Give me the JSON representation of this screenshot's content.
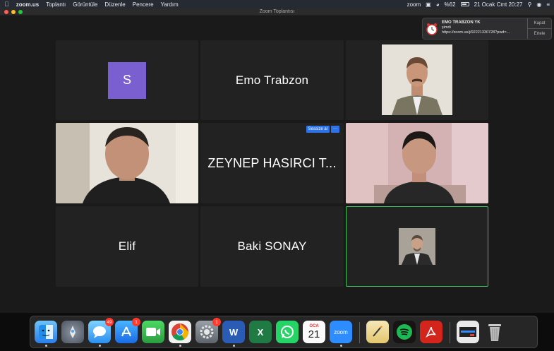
{
  "menubar": {
    "app_name": "zoom.us",
    "menus": [
      "Toplantı",
      "Görüntüle",
      "Düzenle",
      "Pencere",
      "Yardım"
    ],
    "status_app": "zoom",
    "battery": "%62",
    "datetime": "21 Ocak Cmt  20:27"
  },
  "window": {
    "title": "Zoom Toplantısı"
  },
  "tiles": {
    "t1": {
      "avatar_letter": "S"
    },
    "t2": {
      "name": "Emo Trabzon"
    },
    "t5": {
      "name": "ZEYNEP HASIRCI T...",
      "mute_label": "Sessize al",
      "more_label": "···"
    },
    "t7": {
      "name": "Elif"
    },
    "t8": {
      "name": "Baki SONAY"
    }
  },
  "notification": {
    "title": "EMO TRABZON YK",
    "subtitle": "şimdi",
    "url": "https://zoom.us/j/92221330728?pwd=...",
    "close_label": "Kapat",
    "snooze_label": "Ertele"
  },
  "dock": {
    "badges": {
      "messages": "49",
      "appstore": "1",
      "settings": "1"
    },
    "calendar": {
      "month": "OCA",
      "day": "21"
    },
    "zoom_label": "zoom",
    "word_label": "W",
    "excel_label": "X"
  },
  "colors": {
    "active_speaker": "#3fc45a",
    "accent": "#2d72e6",
    "avatar_bg": "#7a5fd0"
  }
}
